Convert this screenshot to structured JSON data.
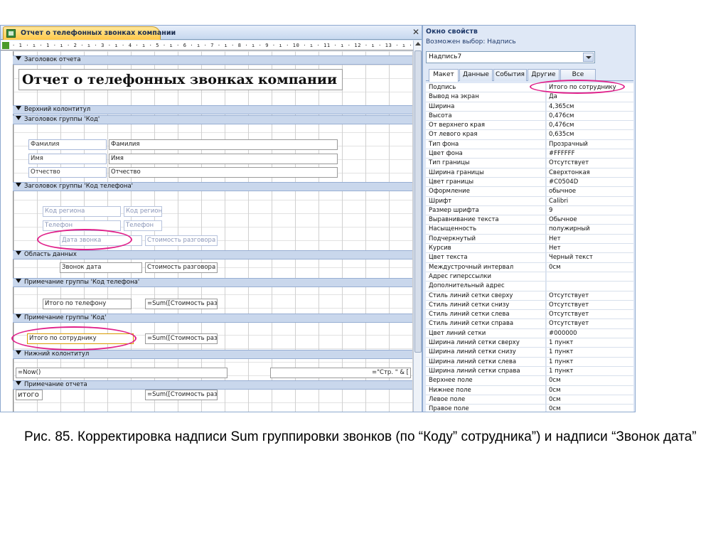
{
  "designer": {
    "tab_title": "Отчет о телефонных звонках компании",
    "close_symbol": "✕",
    "ruler_text": "· 1 · ı · 1 · ı · 2 · ı · 3 · ı · 4 · ı · 5 · ı · 6 · ı · 7 · ı · 8 · ı · 9 · ı · 10 · ı · 11 · ı · 12 · ı · 13 · ı · 14 · ı · 15 · ı · 16 · ı",
    "sections": {
      "report_header": "Заголовок отчета",
      "page_header": "Верхний колонтитул",
      "group_kod_header": "Заголовок группы 'Код'",
      "group_phone_header": "Заголовок группы 'Код телефона'",
      "detail": "Область данных",
      "group_phone_footer": "Примечание группы 'Код телефона'",
      "group_kod_footer": "Примечание группы 'Код'",
      "page_footer": "Нижний колонтитул",
      "report_footer": "Примечание отчета"
    },
    "report_title": "Отчет о телефонных звонках компании",
    "controls": {
      "lbl_familiya": "Фамилия",
      "txt_familiya": "Фамилия",
      "lbl_imya": "Имя",
      "txt_imya": "Имя",
      "lbl_otchestvo": "Отчество",
      "txt_otchestvo": "Отчество",
      "lbl_kod_regiona": "Код региона",
      "txt_kod_regiona": "Код регион",
      "lbl_telefon": "Телефон",
      "txt_telefon": "Телефон",
      "lbl_data_zvonka": "Дата звонка",
      "lbl_stoimost": "Стоимость разговора",
      "txt_zvonok_data": "Звонок дата",
      "txt_stoimost": "Стоимость разговора",
      "lbl_itogo_telefon": "Итого по телефону",
      "sum_telefon": "=Sum([Стоимость раз",
      "lbl_itogo_sotrudnik": "Итого по сотруднику",
      "sum_sotrudnik": "=Sum([Стоимость раз",
      "now_field": "=Now()",
      "page_field": "=\"Стр. \" & [",
      "lbl_itogo": "итого",
      "sum_itogo": "=Sum([Стоимость раз"
    }
  },
  "properties": {
    "title": "Окно свойств",
    "subtitle": "Возможен выбор:  Надпись",
    "selected_object": "Надпись7",
    "tabs": [
      "Макет",
      "Данные",
      "События",
      "Другие",
      "Все"
    ],
    "active_tab": "Макет",
    "rows": [
      {
        "name": "Подпись",
        "value": "Итого по сотруднику"
      },
      {
        "name": "Вывод на экран",
        "value": "Да"
      },
      {
        "name": "Ширина",
        "value": "4,365см"
      },
      {
        "name": "Высота",
        "value": "0,476см"
      },
      {
        "name": "От верхнего края",
        "value": "0,476см"
      },
      {
        "name": "От левого края",
        "value": "0,635см"
      },
      {
        "name": "Тип фона",
        "value": "Прозрачный"
      },
      {
        "name": "Цвет фона",
        "value": "#FFFFFF"
      },
      {
        "name": "Тип границы",
        "value": "Отсутствует"
      },
      {
        "name": "Ширина границы",
        "value": "Сверхтонкая"
      },
      {
        "name": "Цвет границы",
        "value": "#C0504D"
      },
      {
        "name": "Оформление",
        "value": "обычное"
      },
      {
        "name": "Шрифт",
        "value": "Calibri"
      },
      {
        "name": "Размер шрифта",
        "value": "9"
      },
      {
        "name": "Выравнивание текста",
        "value": "Обычное"
      },
      {
        "name": "Насыщенность",
        "value": "полужирный"
      },
      {
        "name": "Подчеркнутый",
        "value": "Нет"
      },
      {
        "name": "Курсив",
        "value": "Нет"
      },
      {
        "name": "Цвет текста",
        "value": "Черный текст"
      },
      {
        "name": "Междустрочный интервал",
        "value": "0см"
      },
      {
        "name": "Адрес гиперссылки",
        "value": ""
      },
      {
        "name": "Дополнительный адрес",
        "value": ""
      },
      {
        "name": "Стиль линий сетки сверху",
        "value": "Отсутствует"
      },
      {
        "name": "Стиль линий сетки снизу",
        "value": "Отсутствует"
      },
      {
        "name": "Стиль линий сетки слева",
        "value": "Отсутствует"
      },
      {
        "name": "Стиль линий сетки справа",
        "value": "Отсутствует"
      },
      {
        "name": "Цвет линий сетки",
        "value": "#000000"
      },
      {
        "name": "Ширина линий сетки сверху",
        "value": "1 пункт"
      },
      {
        "name": "Ширина линий сетки снизу",
        "value": "1 пункт"
      },
      {
        "name": "Ширина линий сетки слева",
        "value": "1 пункт"
      },
      {
        "name": "Ширина линий сетки справа",
        "value": "1 пункт"
      },
      {
        "name": "Верхнее поле",
        "value": "0см"
      },
      {
        "name": "Нижнее поле",
        "value": "0см"
      },
      {
        "name": "Левое поле",
        "value": "0см"
      },
      {
        "name": "Правое поле",
        "value": "0см"
      }
    ]
  },
  "caption": "Рис. 85. Корректировка надписи Sum группировки звонков (по “Коду” сотрудника”) и надписи “Звонок дата”",
  "colors": {
    "highlight": "#e0208a",
    "section_band": "#c9d7ec",
    "tab_active": "#ffc94a"
  }
}
